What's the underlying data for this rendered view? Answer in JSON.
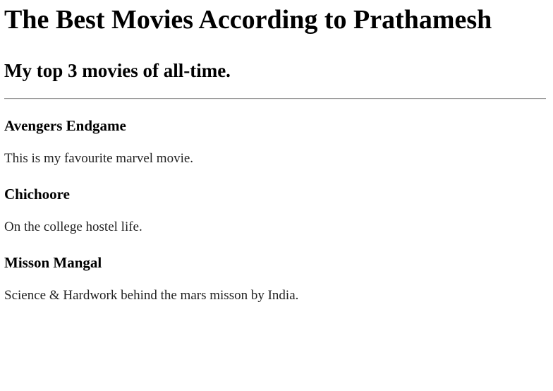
{
  "page": {
    "title": "The Best Movies According to Prathamesh",
    "subtitle": "My top 3 movies of all-time."
  },
  "movies": [
    {
      "name": "Avengers Endgame",
      "description": "This is my favourite marvel movie."
    },
    {
      "name": "Chichoore",
      "description": "On the college hostel life."
    },
    {
      "name": "Misson Mangal",
      "description": "Science & Hardwork behind the mars misson by India."
    }
  ]
}
